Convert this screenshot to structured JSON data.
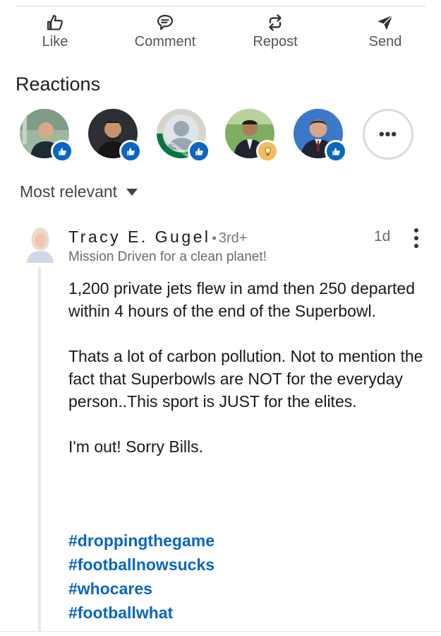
{
  "actions": {
    "like": {
      "label": "Like",
      "icon": "thumbs-up-icon"
    },
    "comment": {
      "label": "Comment",
      "icon": "comment-icon"
    },
    "repost": {
      "label": "Repost",
      "icon": "repost-icon"
    },
    "send": {
      "label": "Send",
      "icon": "send-icon"
    }
  },
  "reactions": {
    "title": "Reactions",
    "avatars": [
      {
        "reaction": "like"
      },
      {
        "reaction": "like"
      },
      {
        "reaction": "like",
        "frame": "#OPENTOWORK"
      },
      {
        "reaction": "insightful"
      },
      {
        "reaction": "like"
      }
    ],
    "more_label": "•••"
  },
  "sort": {
    "label": "Most relevant"
  },
  "comment": {
    "author": "Tracy E. Gugel",
    "degree": "3rd+",
    "headline": "Mission Driven for a clean planet!",
    "time": "1d",
    "paragraphs": [
      "1,200 private jets flew in amd then 250 departed within 4 hours of the end of the Superbowl.",
      "Thats a lot of carbon pollution. Not to mention the fact that Superbowls are NOT for the everyday person..This sport is JUST for the elites.",
      "I'm out! Sorry Bills."
    ],
    "hashtags": [
      "#droppingthegame",
      "#footballnowsucks",
      "#whocares",
      "#footballwhat"
    ]
  },
  "colors": {
    "accent": "#0a66c2",
    "insight_badge": "#f5bb5c",
    "open_to_work": "#057642"
  }
}
